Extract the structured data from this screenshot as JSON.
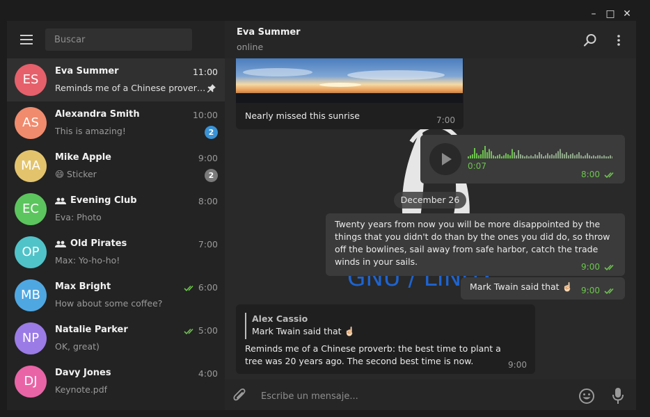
{
  "window": {
    "minimize_glyph": "–",
    "maximize_glyph": "□",
    "close_glyph": "✕"
  },
  "sidebar": {
    "search_placeholder": "Buscar",
    "chats": [
      {
        "initials": "ES",
        "name": "Eva Summer",
        "time": "11:00",
        "preview": "Reminds me of a Chinese prover…",
        "color": "#e5606b",
        "pinned": true,
        "active": true
      },
      {
        "initials": "AS",
        "name": "Alexandra Smith",
        "time": "10:00",
        "preview": "This is amazing!",
        "color": "#f08b6d",
        "badge": "2",
        "badge_color": "#3a93d6"
      },
      {
        "initials": "MA",
        "name": "Mike Apple",
        "time": "9:00",
        "preview_emoji": "😄",
        "preview": "Sticker",
        "color": "#e3c46d",
        "badge": "2",
        "badge_color": "#7a7a7a"
      },
      {
        "initials": "EC",
        "name": "Evening Club",
        "time": "8:00",
        "preview": "Eva: Photo",
        "color": "#5cc55e",
        "group": true
      },
      {
        "initials": "OP",
        "name": "Old Pirates",
        "time": "7:00",
        "preview": "Max: Yo-ho-ho!",
        "color": "#50c3c9",
        "group": true
      },
      {
        "initials": "MB",
        "name": "Max Bright",
        "time": "6:00",
        "preview": "How about some coffee?",
        "color": "#4fa7e2",
        "read": true
      },
      {
        "initials": "NP",
        "name": "Natalie Parker",
        "time": "5:00",
        "preview": "OK, great)",
        "color": "#9b7be6",
        "read": true
      },
      {
        "initials": "DJ",
        "name": "Davy Jones",
        "time": "4:00",
        "preview": "Keynote.pdf",
        "color": "#e964a6"
      }
    ]
  },
  "header": {
    "name": "Eva Summer",
    "status": "online"
  },
  "background": {
    "gnu_text": "GNU / LINUX"
  },
  "messages": {
    "photo_caption": "Nearly missed this sunrise",
    "photo_time": "7:00",
    "voice_duration": "0:07",
    "voice_time": "8:00",
    "date_divider": "December 26",
    "quote_text": "Twenty years from now you will be more disappointed by the things that you didn't do than by the ones you did do, so throw off the bowlines, sail away from safe harbor, catch the trade winds in your sails.",
    "quote_time": "9:00",
    "mark_text": "Mark Twain said that ☝🏻",
    "mark_time": "9:00",
    "reply_author": "Alex Cassio",
    "reply_quote": "Mark Twain said that ☝🏻",
    "reply_text": "Reminds me of a Chinese proverb: the best time to plant a tree was 20 years ago. The second best time is now.",
    "reply_time": "9:00"
  },
  "composer": {
    "placeholder": "Escribe un mensaje..."
  },
  "colors": {
    "accent_green": "#6dc44e",
    "unread_badge": "#3a93d6",
    "muted_badge": "#7a7a7a"
  },
  "icons": [
    "hamburger-icon",
    "search-icon",
    "more-icon",
    "pin-icon",
    "group-icon",
    "double-check-icon",
    "play-icon",
    "attach-icon",
    "emoji-icon",
    "mic-icon"
  ]
}
